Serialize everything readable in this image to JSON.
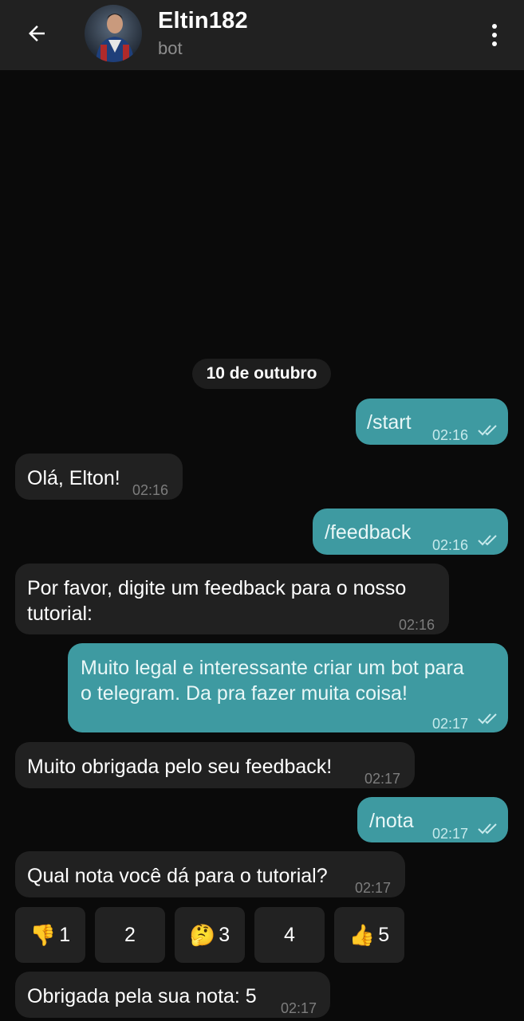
{
  "header": {
    "back_icon": "arrow-left-icon",
    "title": "Eltin182",
    "subtitle": "bot",
    "menu_icon": "more-vertical-icon"
  },
  "date_separator": "10 de outubro",
  "messages": [
    {
      "dir": "out",
      "text": "/start",
      "time": "02:16",
      "status": "read"
    },
    {
      "dir": "in",
      "text": "Olá, Elton!",
      "time": "02:16"
    },
    {
      "dir": "out",
      "text": "/feedback",
      "time": "02:16",
      "status": "read"
    },
    {
      "dir": "in",
      "text_lines": [
        "Por favor, digite um feedback para o nosso",
        "tutorial:"
      ],
      "time": "02:16"
    },
    {
      "dir": "out",
      "text_lines": [
        "Muito legal e interessante criar um bot para",
        "o telegram. Da pra fazer muita coisa!"
      ],
      "time": "02:17",
      "status": "read"
    },
    {
      "dir": "in",
      "text": "Muito obrigada pelo seu feedback!",
      "time": "02:17"
    },
    {
      "dir": "out",
      "text": "/nota",
      "time": "02:17",
      "status": "read"
    },
    {
      "dir": "in",
      "text": "Qual nota você dá para o tutorial?",
      "time": "02:17"
    },
    {
      "dir": "in",
      "text": "Obrigada pela sua nota: 5",
      "time": "02:17"
    }
  ],
  "rating_buttons": [
    {
      "emoji": "👎",
      "label": "1"
    },
    {
      "emoji": "",
      "label": "2"
    },
    {
      "emoji": "🤔",
      "label": "3"
    },
    {
      "emoji": "",
      "label": "4"
    },
    {
      "emoji": "👍",
      "label": "5"
    }
  ],
  "colors": {
    "background": "#0a0a0a",
    "header": "#212121",
    "incoming_bubble": "#212121",
    "outgoing_bubble": "#3e9aa1"
  }
}
